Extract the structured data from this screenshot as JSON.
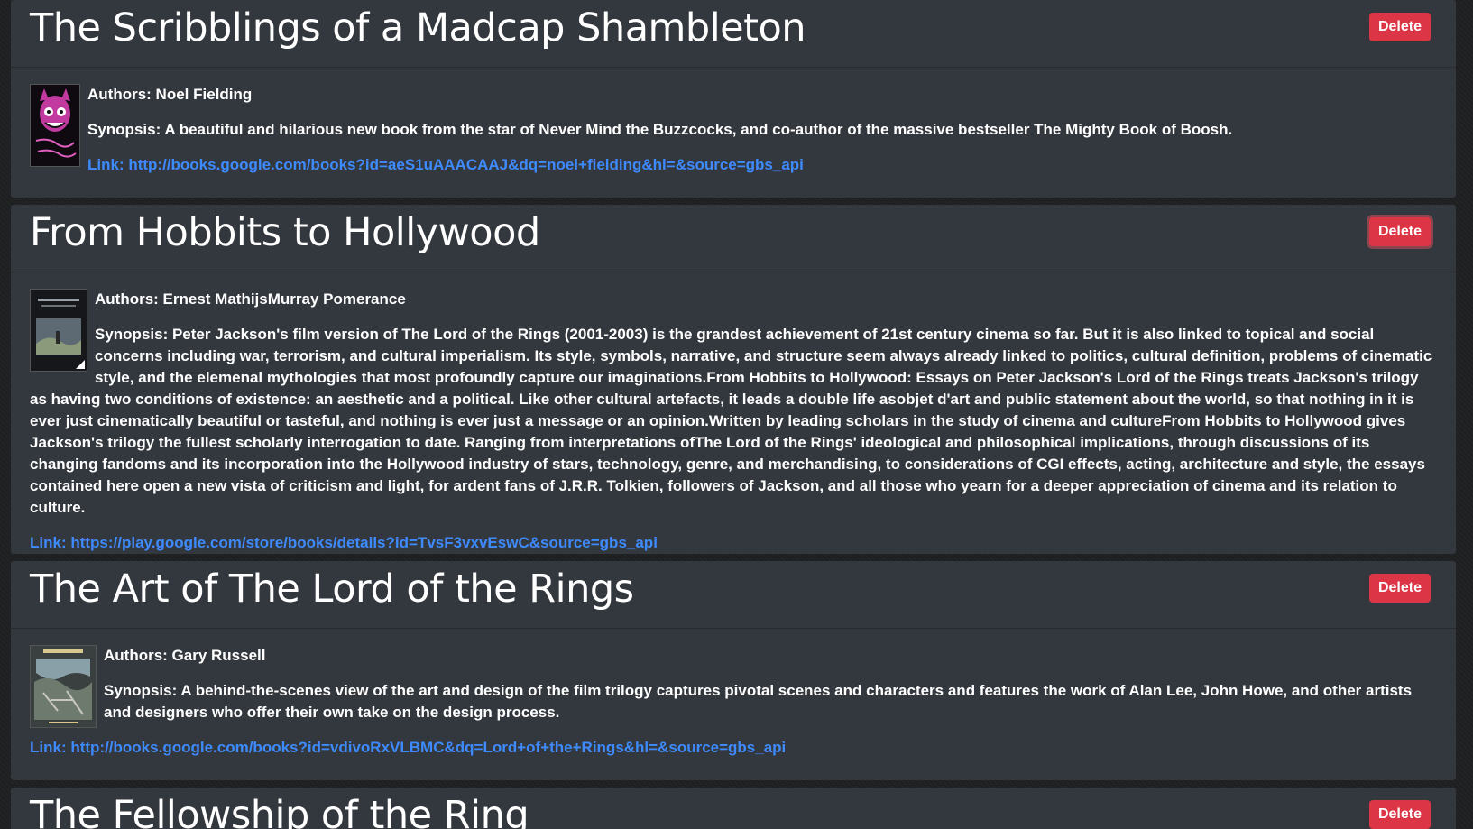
{
  "books": [
    {
      "title": "The Scribblings of a Madcap Shambleton",
      "delete_label": "Delete",
      "authors": "Authors: Noel Fielding",
      "synopsis": "Synopsis: A beautiful and hilarious new book from the star of Never Mind the Buzzcocks, and co-author of the massive bestseller The Mighty Book of Boosh.",
      "link": "Link: http://books.google.com/books?id=aeS1uAAACAAJ&dq=noel+fielding&hl=&source=gbs_api",
      "cover_icon": "book-cover-pink-monster"
    },
    {
      "title": "From Hobbits to Hollywood",
      "delete_label": "Delete",
      "authors": "Authors: Ernest MathijsMurray Pomerance",
      "synopsis": "Synopsis: Peter Jackson's film version of The Lord of the Rings (2001-2003) is the grandest achievement of 21st century cinema so far. But it is also linked to topical and social concerns including war, terrorism, and cultural imperialism. Its style, symbols, narrative, and structure seem always already linked to politics, cultural definition, problems of cinematic style, and the elemenal mythologies that most profoundly capture our imaginations.From Hobbits to Hollywood: Essays on Peter Jackson's Lord of the Rings treats Jackson's trilogy as having two conditions of existence: an aesthetic and a political. Like other cultural artefacts, it leads a double life asobjet d'art and public statement about the world, so that nothing in it is ever just cinematically beautiful or tasteful, and nothing is ever just a message or an opinion.Written by leading scholars in the study of cinema and cultureFrom Hobbits to Hollywood gives Jackson's trilogy the fullest scholarly interrogation to date. Ranging from interpretations ofThe Lord of the Rings' ideological and philosophical implications, through discussions of its changing fandoms and its incorporation into the Hollywood industry of stars, technology, genre, and merchandising, to considerations of CGI effects, acting, architecture and style, the essays contained here open a new vista of criticism and light, for ardent fans of J.R.R. Tolkien, followers of Jackson, and all those who yearn for a deeper appreciation of cinema and its relation to culture.",
      "link": "Link: https://play.google.com/store/books/details?id=TvsF3vxvEswC&source=gbs_api",
      "cover_icon": "book-cover-dark-landscape"
    },
    {
      "title": "The Art of The Lord of the Rings",
      "delete_label": "Delete",
      "authors": "Authors: Gary Russell",
      "synopsis": "Synopsis: A behind-the-scenes view of the art and design of the film trilogy captures pivotal scenes and characters and features the work of Alan Lee, John Howe, and other artists and designers who offer their own take on the design process.",
      "link": "Link: http://books.google.com/books?id=vdivoRxVLBMC&dq=Lord+of+the+Rings&hl=&source=gbs_api",
      "cover_icon": "book-cover-battle-art"
    },
    {
      "title": "The Fellowship of the Ring",
      "delete_label": "Delete"
    }
  ],
  "colors": {
    "card_bg": "#33373e",
    "page_bg": "#1e1f21",
    "delete_bg": "#dc3545",
    "link": "#3d8bfd"
  }
}
